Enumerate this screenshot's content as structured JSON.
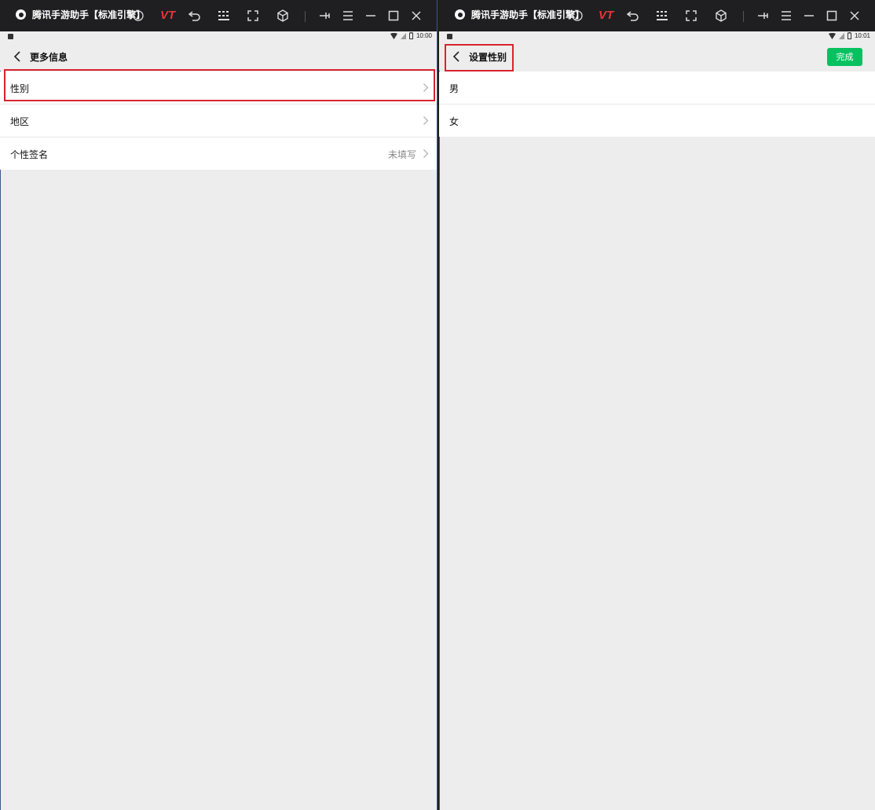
{
  "window": {
    "title": "腾讯手游助手【标准引擎】",
    "vt_label": "VT",
    "icons": [
      "help-icon",
      "vt-logo",
      "undo-icon",
      "keyboard-icon",
      "fullscreen-icon",
      "cube-icon",
      "pin-icon",
      "menu-icon",
      "minimize-icon",
      "maximize-icon",
      "close-icon"
    ]
  },
  "accent_colors": {
    "primary_green": "#07c160",
    "highlight_red": "#d9232e",
    "titlebar": "#1f1f21",
    "background": "#ededed"
  },
  "left_screen": {
    "status_time": "10:00",
    "nav_title": "更多信息",
    "rows": [
      {
        "label": "性别",
        "value": ""
      },
      {
        "label": "地区",
        "value": ""
      },
      {
        "label": "个性签名",
        "value": "未填写"
      }
    ]
  },
  "right_screen": {
    "status_time": "10:01",
    "nav_title": "设置性别",
    "done_label": "完成",
    "options": [
      {
        "label": "男"
      },
      {
        "label": "女"
      }
    ]
  }
}
